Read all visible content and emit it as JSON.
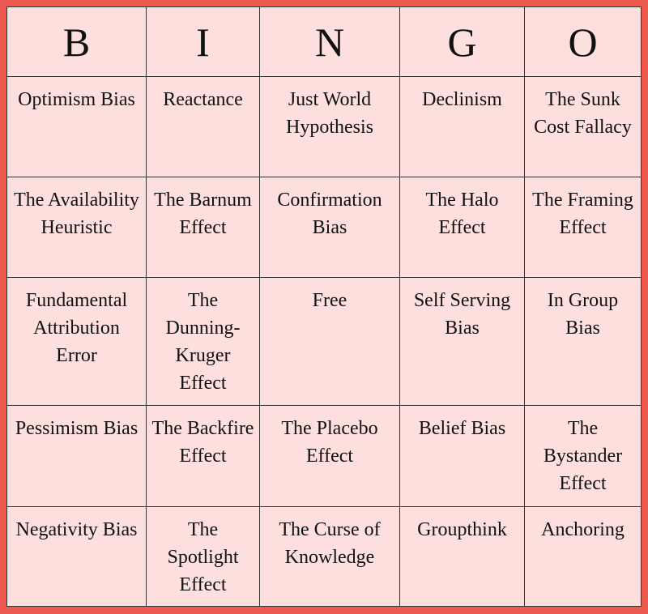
{
  "header": [
    "B",
    "I",
    "N",
    "G",
    "O"
  ],
  "rows": [
    [
      "Optimism Bias",
      "Reactance",
      "Just World Hypothesis",
      "Declinism",
      "The Sunk Cost Fallacy"
    ],
    [
      "The Availability Heuristic",
      "The Barnum Effect",
      "Confirmation Bias",
      "The Halo Effect",
      "The Framing Effect"
    ],
    [
      "Fundamental Attribution Error",
      "The Dunning-Kruger Effect",
      "Free",
      "Self Serving Bias",
      "In Group Bias"
    ],
    [
      "Pessimism Bias",
      "The Backfire Effect",
      "The Placebo Effect",
      "Belief Bias",
      "The Bystander Effect"
    ],
    [
      "Negativity Bias",
      "The Spotlight Effect",
      "The Curse of Knowledge",
      "Groupthink",
      "Anchoring"
    ]
  ],
  "colors": {
    "frame": "#ee5a50",
    "cell": "#fde0de",
    "grid": "#333333"
  }
}
